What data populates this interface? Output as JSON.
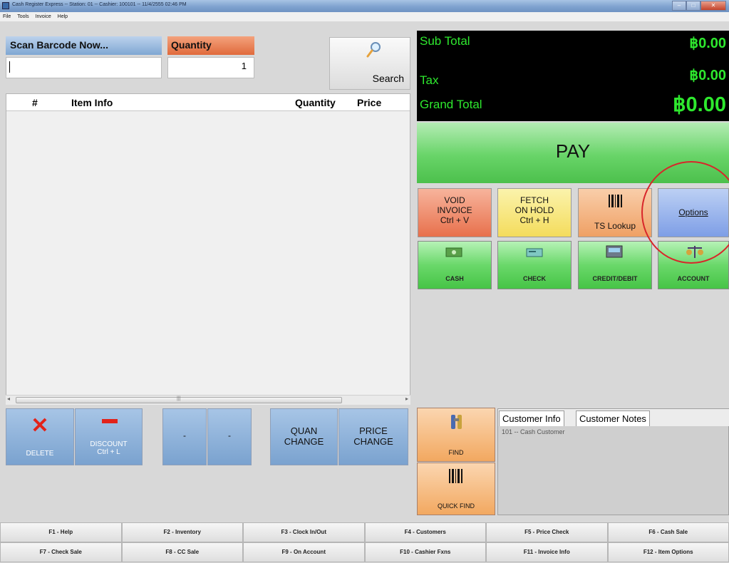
{
  "window": {
    "title": "Cash Register Express -- Station: 01 -- Cashier: 100101 -- 11/4/2555 02:46 PM",
    "controls": [
      "minimize",
      "maximize",
      "close"
    ]
  },
  "menu": [
    "File",
    "Tools",
    "Invoice",
    "Help"
  ],
  "scan": {
    "label": "Scan Barcode Now...",
    "value": "",
    "quantity_label": "Quantity",
    "quantity_value": "1",
    "search_label": "Search"
  },
  "grid": {
    "columns": [
      "#",
      "Item Info",
      "Quantity",
      "Price"
    ]
  },
  "totals": {
    "subtotal_label": "Sub Total",
    "subtotal_value": "฿0.00",
    "tax_label": "Tax",
    "tax_value": "฿0.00",
    "grand_label": "Grand Total",
    "grand_value": "฿0.00"
  },
  "actions": {
    "pay": "PAY",
    "void_lines": [
      "VOID",
      "INVOICE",
      "Ctrl + V"
    ],
    "fetch_lines": [
      "FETCH",
      "ON HOLD",
      "Ctrl + H"
    ],
    "ts_lookup": "TS Lookup",
    "options": "Options"
  },
  "tenders": [
    "CASH",
    "CHECK",
    "CREDIT/DEBIT",
    "ACCOUNT"
  ],
  "bottom_buttons": {
    "delete": "DELETE",
    "discount_lines": [
      "DISCOUNT",
      "Ctrl + L"
    ],
    "dot1": "-",
    "dot2": "-",
    "quan_lines": [
      "QUAN",
      "CHANGE"
    ],
    "price_lines": [
      "PRICE",
      "CHANGE"
    ],
    "find": "FIND",
    "quick_find": "QUICK FIND"
  },
  "customer": {
    "tabs": [
      "Customer Info",
      "Customer Notes"
    ],
    "info": "101 -- Cash Customer"
  },
  "fkeys": [
    "F1 - Help",
    "F2 - Inventory",
    "F3 - Clock In/Out",
    "F4 - Customers",
    "F5 - Price Check",
    "F6 - Cash Sale",
    "F7 - Check Sale",
    "F8 - CC Sale",
    "F9 - On Account",
    "F10 - Cashier Fxns",
    "F11 - Invoice Info",
    "F12 - Item Options"
  ],
  "colors": {
    "total_text": "#2ee82e",
    "pay_green": "#68d468",
    "highlight_ring": "#d8262a"
  }
}
